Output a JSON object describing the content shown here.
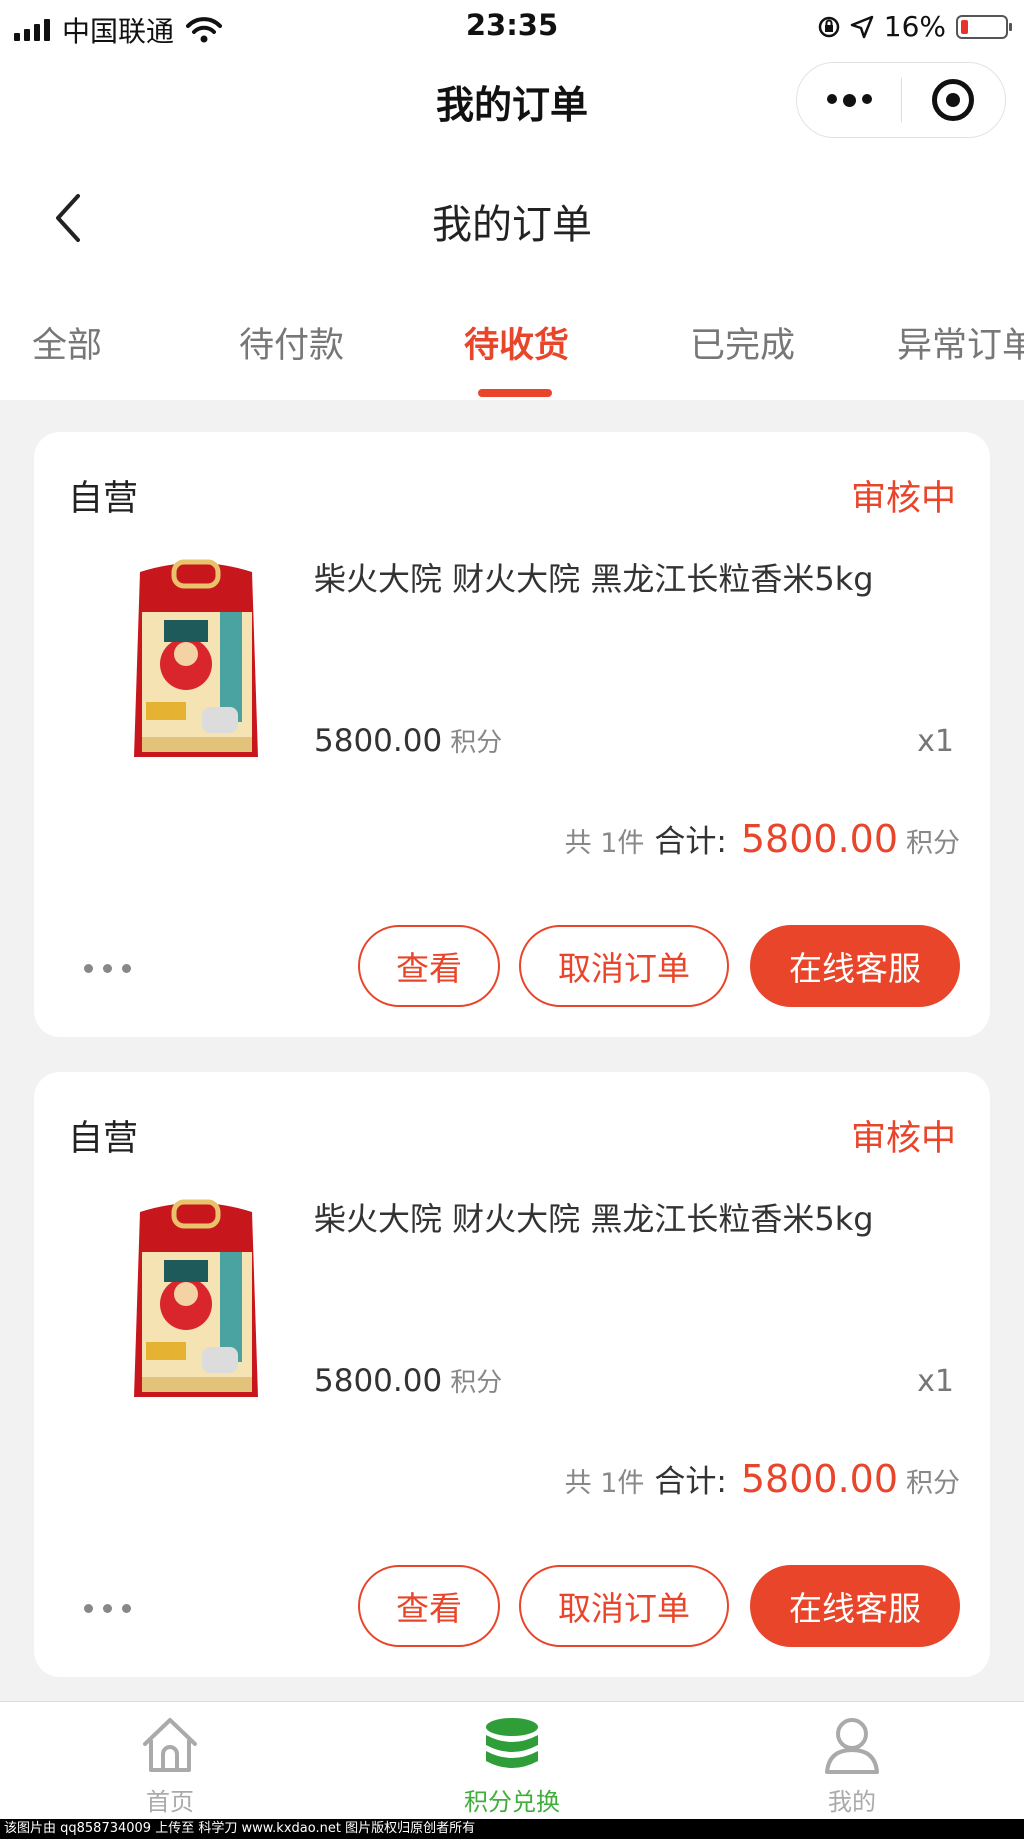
{
  "status_bar": {
    "carrier": "中国联通",
    "time": "23:35",
    "battery_percent_label": "16%",
    "battery_level": 0.16,
    "battery_color": "#e8322c"
  },
  "mini_program": {
    "title": "我的订单",
    "more_icon": "more-dots-icon",
    "close_icon": "target-close-icon"
  },
  "page": {
    "title": "我的订单",
    "back_icon": "chevron-left-icon"
  },
  "tabs": [
    {
      "label": "全部",
      "active": false
    },
    {
      "label": "待付款",
      "active": false
    },
    {
      "label": "待收货",
      "active": true
    },
    {
      "label": "已完成",
      "active": false
    },
    {
      "label": "异常订单",
      "active": false
    }
  ],
  "orders": [
    {
      "shop": "自营",
      "status": "审核中",
      "product_name": "柴火大院 财火大院 黑龙江长粒香米5kg",
      "price": "5800.00",
      "price_unit": "积分",
      "quantity": "x1",
      "count_label": "共 1件",
      "total_label": "合计:",
      "total": "5800.00",
      "total_unit": "积分",
      "buttons": {
        "view": "查看",
        "cancel": "取消订单",
        "service": "在线客服"
      }
    },
    {
      "shop": "自营",
      "status": "审核中",
      "product_name": "柴火大院 财火大院 黑龙江长粒香米5kg",
      "price": "5800.00",
      "price_unit": "积分",
      "quantity": "x1",
      "count_label": "共 1件",
      "total_label": "合计:",
      "total": "5800.00",
      "total_unit": "积分",
      "buttons": {
        "view": "查看",
        "cancel": "取消订单",
        "service": "在线客服"
      }
    }
  ],
  "tabbar": [
    {
      "label": "首页",
      "icon": "home-icon",
      "active": false
    },
    {
      "label": "积分兑换",
      "icon": "coin-stack-icon",
      "active": true
    },
    {
      "label": "我的",
      "icon": "user-icon",
      "active": false
    }
  ],
  "colors": {
    "accent": "#e8452a",
    "tab_active_green": "#3fae3b",
    "page_background": "#f2f2f2"
  },
  "watermark": "该图片由 qq858734009 上传至 科学刀 www.kxdao.net 图片版权归原创者所有"
}
